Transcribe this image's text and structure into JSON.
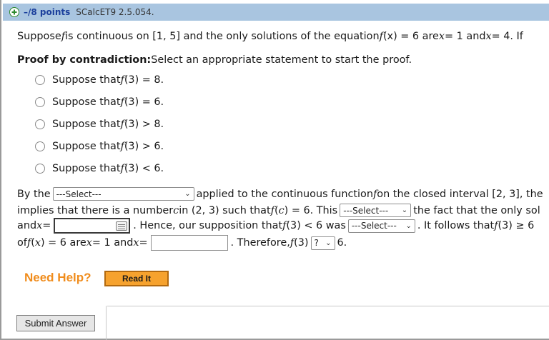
{
  "header": {
    "points": "–/8 points",
    "code": "SCalcET9 2.5.054."
  },
  "question": {
    "intro_a": "Suppose ",
    "intro_f": "f",
    "intro_b": " is continuous on [1, 5] and the only solutions of the equation ",
    "intro_fx": "f",
    "intro_c": "(x) = 6 are ",
    "intro_x1": "x",
    "intro_d": " = 1 and ",
    "intro_x2": "x",
    "intro_e": " = 4. If"
  },
  "proof": {
    "heading": "Proof by contradiction:",
    "instruction": " Select an appropriate statement to start the proof."
  },
  "options": [
    {
      "pre": "Suppose that ",
      "f": "f",
      "post": "(3) = 8."
    },
    {
      "pre": "Suppose that ",
      "f": "f",
      "post": "(3) = 6."
    },
    {
      "pre": "Suppose that ",
      "f": "f",
      "post": "(3) > 8."
    },
    {
      "pre": "Suppose that ",
      "f": "f",
      "post": "(3) > 6."
    },
    {
      "pre": "Suppose that ",
      "f": "f",
      "post": "(3) < 6."
    }
  ],
  "para": {
    "l1_a": "By the",
    "select1": "---Select---",
    "l1_b": "applied to the continuous function ",
    "l1_f": "f",
    "l1_c": " on the closed interval [2, 3], the",
    "l2_a": "implies that there is a number ",
    "l2_c": "c",
    "l2_b": " in (2, 3) such that ",
    "l2_f": "f",
    "l2_paren": "(",
    "l2_c2": "c",
    "l2_d": ") = 6. This",
    "select2": "---Select---",
    "l2_e": "the fact that the only sol",
    "l3_a": "and ",
    "l3_x": "x",
    "l3_b": " =",
    "l3_c": ". Hence, our supposition that ",
    "l3_f": "f",
    "l3_d": "(3) < 6 was",
    "select3": "---Select---",
    "l3_e": ". It follows that ",
    "l3_f2": "f",
    "l3_g": "(3) ≥ 6",
    "l4_a": "of ",
    "l4_f": "f",
    "l4_b": "(",
    "l4_x": "x",
    "l4_c": ") = 6 are ",
    "l4_x2": "x",
    "l4_d": " = 1 and ",
    "l4_x3": "x",
    "l4_e": " =",
    "l4_g": ". Therefore, ",
    "l4_f2": "f",
    "l4_h": "(3)",
    "select4": "?",
    "l4_i": "6."
  },
  "help": {
    "label": "Need Help?",
    "read_it": "Read It"
  },
  "submit": "Submit Answer",
  "colors": {
    "header_bg": "#a9c5e0",
    "points_text": "#1b3f9c",
    "help_text": "#f08c1c",
    "read_it_bg": "#f6a22e"
  },
  "icons": {
    "add": "plus-circle-icon",
    "dropdown": "chevron-down-icon",
    "keyboard": "keyboard-icon"
  }
}
